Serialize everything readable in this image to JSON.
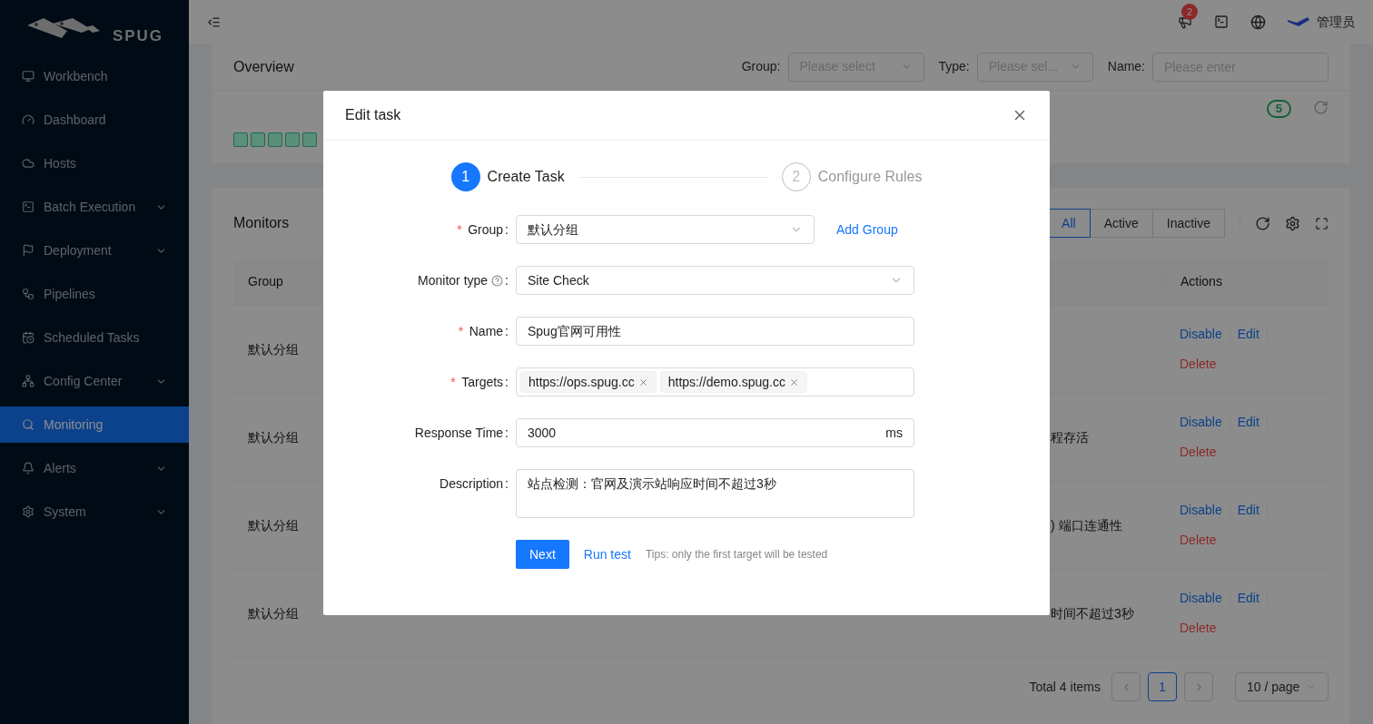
{
  "sidebar": {
    "logo_text": "SPUG",
    "items": [
      {
        "label": "Workbench",
        "expandable": false,
        "selected": false
      },
      {
        "label": "Dashboard",
        "expandable": false,
        "selected": false
      },
      {
        "label": "Hosts",
        "expandable": false,
        "selected": false
      },
      {
        "label": "Batch Execution",
        "expandable": true,
        "selected": false
      },
      {
        "label": "Deployment",
        "expandable": true,
        "selected": false
      },
      {
        "label": "Pipelines",
        "expandable": false,
        "selected": false
      },
      {
        "label": "Scheduled Tasks",
        "expandable": false,
        "selected": false
      },
      {
        "label": "Config Center",
        "expandable": true,
        "selected": false
      },
      {
        "label": "Monitoring",
        "expandable": false,
        "selected": true
      },
      {
        "label": "Alerts",
        "expandable": true,
        "selected": false
      },
      {
        "label": "System",
        "expandable": true,
        "selected": false
      }
    ]
  },
  "header": {
    "notification_count": "2",
    "user": "管理员"
  },
  "overview": {
    "title": "Overview",
    "filters": [
      {
        "label": "Group:",
        "placeholder": "Please select",
        "kind": "select"
      },
      {
        "label": "Type:",
        "placeholder": "Please sel...",
        "kind": "select"
      },
      {
        "label": "Name:",
        "placeholder": "Please enter",
        "kind": "input"
      }
    ],
    "count": "5",
    "status_blocks": [
      {
        "color": "#5a8f7b"
      },
      {
        "color": "#5a8f7b"
      },
      {
        "color": "#5a8f7b"
      },
      {
        "color": "#5a8f7b"
      },
      {
        "color": "#5a8f7b"
      }
    ]
  },
  "monitors": {
    "title": "Monitors",
    "filter_tabs": [
      {
        "label": "All",
        "selected": true
      },
      {
        "label": "Active",
        "selected": false
      },
      {
        "label": "Inactive",
        "selected": false
      }
    ],
    "columns": [
      "Group",
      "Actions"
    ],
    "rows": [
      {
        "group": "默认分组",
        "description_fragment": "",
        "actions": [
          {
            "label": "Disable",
            "kind": "link"
          },
          {
            "label": "Edit",
            "kind": "link"
          },
          {
            "label": "Delete",
            "kind": "danger"
          }
        ]
      },
      {
        "group": "默认分组",
        "description_fragment": "程存活",
        "actions": [
          {
            "label": "Disable",
            "kind": "link"
          },
          {
            "label": "Edit",
            "kind": "link"
          },
          {
            "label": "Delete",
            "kind": "danger"
          }
        ]
      },
      {
        "group": "默认分组",
        "description_fragment": ") 端口连通性",
        "actions": [
          {
            "label": "Disable",
            "kind": "link"
          },
          {
            "label": "Edit",
            "kind": "link"
          },
          {
            "label": "Delete",
            "kind": "danger"
          }
        ]
      },
      {
        "group": "默认分组",
        "description_fragment": "时间不超过3秒",
        "actions": [
          {
            "label": "Disable",
            "kind": "link"
          },
          {
            "label": "Edit",
            "kind": "link"
          },
          {
            "label": "Delete",
            "kind": "danger"
          }
        ]
      }
    ],
    "pagination": {
      "total": "Total 4 items",
      "page": "1",
      "page_size": "10 / page"
    }
  },
  "modal": {
    "title": "Edit task",
    "required_mark": "*",
    "label_colon": ":",
    "steps": [
      {
        "number": "1",
        "label": "Create Task",
        "selected": true
      },
      {
        "number": "2",
        "label": "Configure Rules",
        "selected": false
      }
    ],
    "fields": [
      {
        "label": "Group",
        "required": true,
        "kind": "select",
        "value": "默认分组",
        "extra_link": "Add Group"
      },
      {
        "label": "Monitor type",
        "required": false,
        "help": true,
        "kind": "select",
        "value": "Site Check"
      },
      {
        "label": "Name",
        "required": true,
        "kind": "input",
        "value": "Spug官网可用性"
      },
      {
        "label": "Targets",
        "required": true,
        "kind": "tags",
        "tags": [
          "https://ops.spug.cc",
          "https://demo.spug.cc"
        ]
      },
      {
        "label": "Response Time",
        "required": false,
        "kind": "input",
        "value": "3000",
        "suffix": "ms"
      },
      {
        "label": "Description",
        "required": false,
        "kind": "textarea",
        "value": "站点检测：官网及演示站响应时间不超过3秒"
      }
    ],
    "primary_button": "Next",
    "test_link": "Run test",
    "tip": "Tips: only the first target will be tested"
  }
}
